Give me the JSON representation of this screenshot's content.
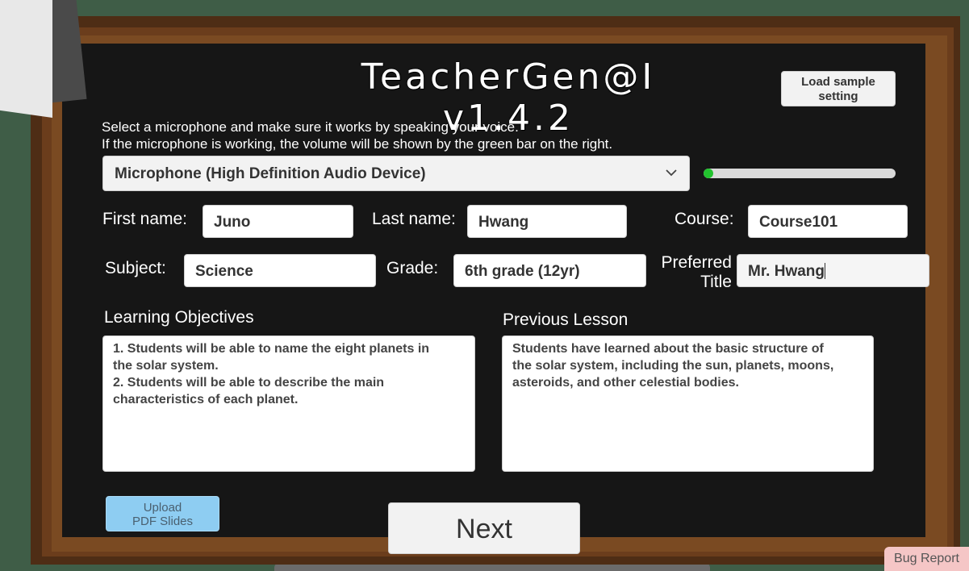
{
  "app": {
    "title": "TeacherGen@I v1.4.2"
  },
  "toolbar": {
    "load_sample_label_line1": "Load sample",
    "load_sample_label_line2": "setting"
  },
  "instructions": {
    "line1": "Select a microphone and make sure it works by speaking your voice.",
    "line2": "If the microphone is working, the volume will be shown by the green bar on the right."
  },
  "microphone": {
    "selected": "Microphone (High Definition Audio Device)",
    "volume_level": 0.03
  },
  "form": {
    "first_name": {
      "label": "First name:",
      "value": "Juno"
    },
    "last_name": {
      "label": "Last name:",
      "value": "Hwang"
    },
    "course": {
      "label": "Course:",
      "value": "Course101"
    },
    "subject": {
      "label": "Subject:",
      "value": "Science"
    },
    "grade": {
      "label": "Grade:",
      "value": "6th grade (12yr)"
    },
    "preferred_title": {
      "label_line1": "Preferred",
      "label_line2": "Title",
      "value": "Mr. Hwang"
    }
  },
  "learning_objectives": {
    "label": "Learning Objectives",
    "lines": [
      "1. Students will be able to name the eight planets in",
      "the solar system.",
      "2. Students will be able to describe the main",
      "characteristics of each planet."
    ]
  },
  "previous_lesson": {
    "label": "Previous Lesson",
    "lines": [
      "Students have learned about the basic structure of",
      "the solar system, including the sun, planets, moons,",
      "asteroids, and other celestial bodies."
    ]
  },
  "buttons": {
    "upload_line1": "Upload",
    "upload_line2": "PDF Slides",
    "next": "Next",
    "bug_report": "Bug Report"
  },
  "colors": {
    "board": "#161616",
    "volume_fill": "#22c22e",
    "upload_button": "#8ecdf2",
    "bug_button": "#f5c6c6"
  }
}
